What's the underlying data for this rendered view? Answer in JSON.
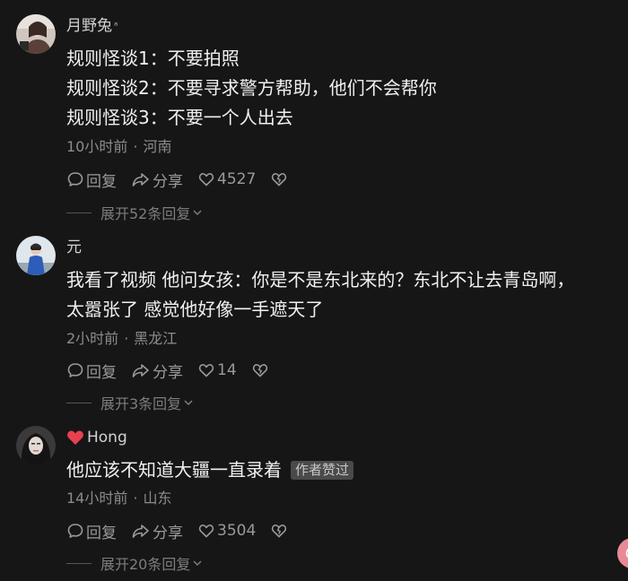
{
  "comments": [
    {
      "author": "月野兔",
      "author_suffix": "ᵃ",
      "has_heart": false,
      "lines": [
        "规则怪谈1：不要拍照",
        "规则怪谈2：不要寻求警方帮助，他们不会帮你",
        "规则怪谈3：不要一个人出去"
      ],
      "author_liked_label": "",
      "time": "10小时前",
      "location": "河南",
      "reply_label": "回复",
      "share_label": "分享",
      "likes": "4527",
      "expand_label": "展开52条回复"
    },
    {
      "author": "元",
      "author_suffix": "",
      "has_heart": false,
      "lines": [
        "我看了视频 他问女孩：你是不是东北来的？东北不让去青岛啊，",
        "太嚣张了 感觉他好像一手遮天了"
      ],
      "author_liked_label": "",
      "time": "2小时前",
      "location": "黑龙江",
      "reply_label": "回复",
      "share_label": "分享",
      "likes": "14",
      "expand_label": "展开3条回复"
    },
    {
      "author": "Hong",
      "author_suffix": "",
      "has_heart": true,
      "lines": [
        "他应该不知道大疆一直录着"
      ],
      "author_liked_label": "作者赞过",
      "time": "14小时前",
      "location": "山东",
      "reply_label": "回复",
      "share_label": "分享",
      "likes": "3504",
      "expand_label": "展开20条回复"
    }
  ],
  "colors": {
    "background": "#161616",
    "heart": "#e8404f",
    "floating_button": "#e88a95"
  },
  "icons": {
    "reply": "speech-bubble-icon",
    "share": "share-arrow-icon",
    "like": "heart-outline-icon",
    "dislike": "broken-heart-icon",
    "expand": "chevron-down-icon"
  }
}
